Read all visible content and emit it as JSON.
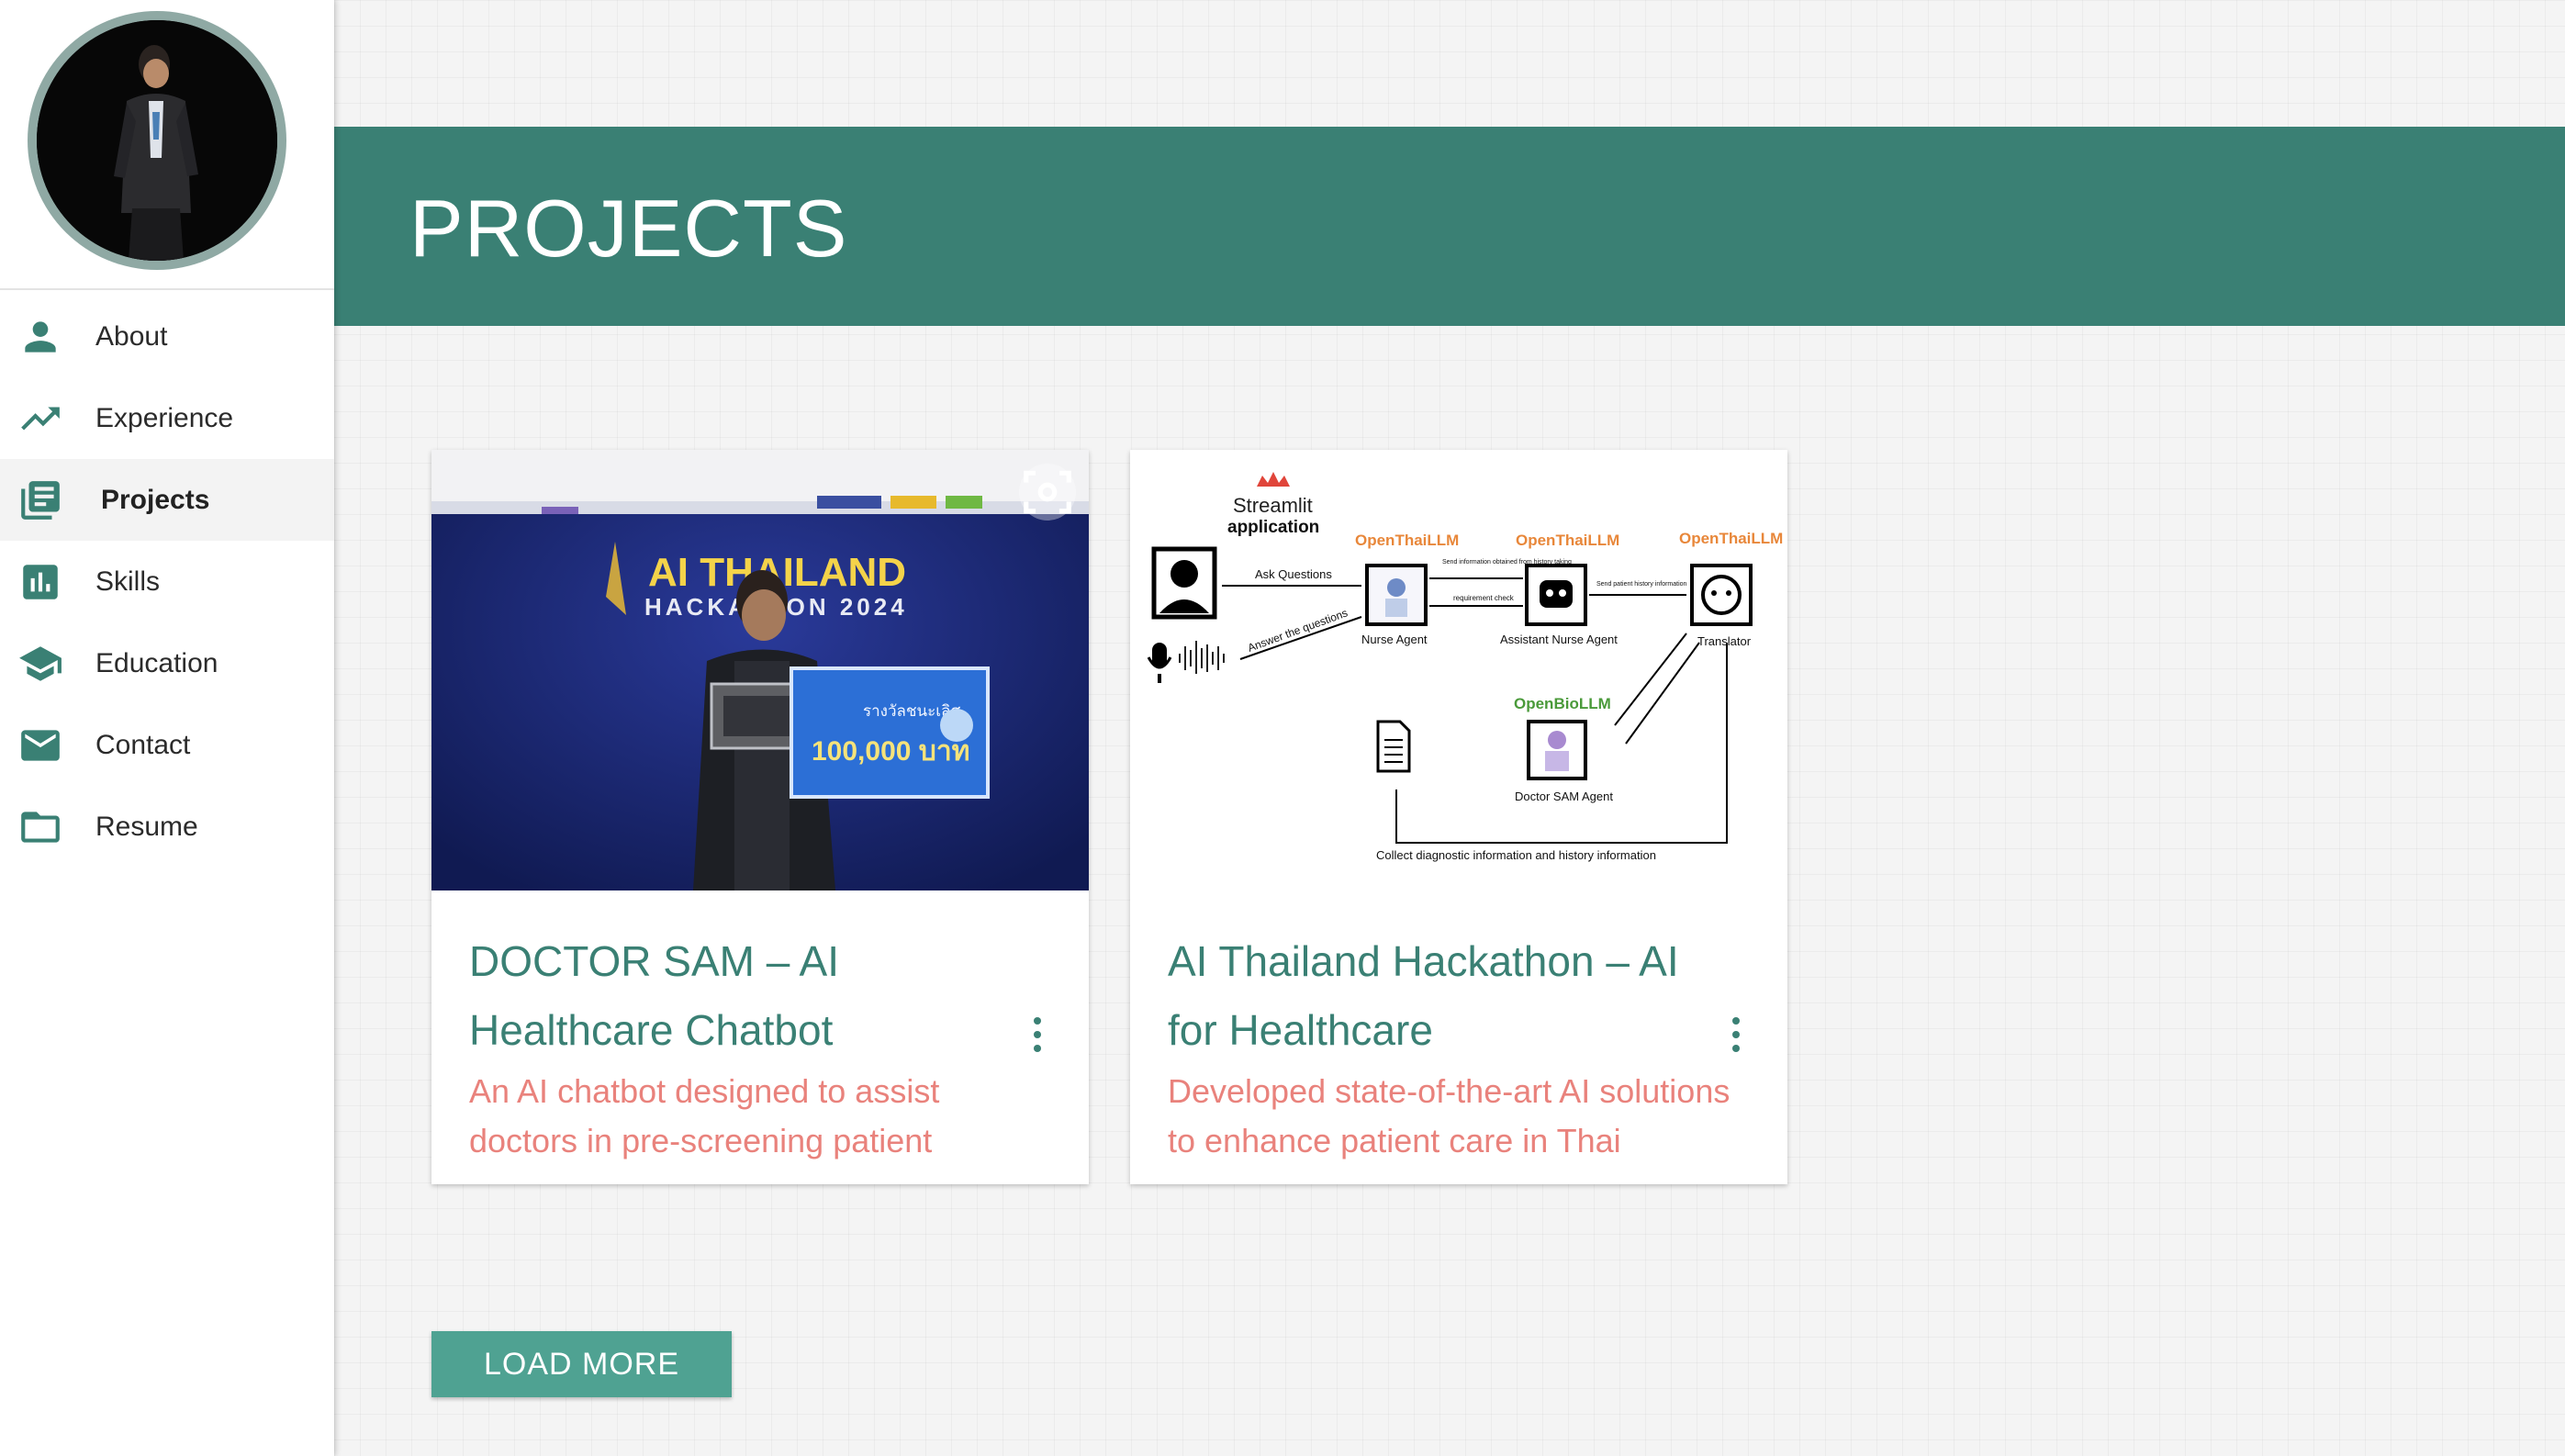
{
  "nav": {
    "items": [
      {
        "label": "About",
        "icon": "person-icon"
      },
      {
        "label": "Experience",
        "icon": "trending-up-icon"
      },
      {
        "label": "Projects",
        "icon": "article-icon",
        "active": true
      },
      {
        "label": "Skills",
        "icon": "bar-chart-icon"
      },
      {
        "label": "Education",
        "icon": "school-icon"
      },
      {
        "label": "Contact",
        "icon": "mail-icon"
      },
      {
        "label": "Resume",
        "icon": "folder-icon"
      }
    ]
  },
  "header": {
    "title": "PROJECTS"
  },
  "cards": [
    {
      "title": "DOCTOR SAM – AI Healthcare Chatbot",
      "description": "An AI chatbot designed to assist doctors in pre-screening patient",
      "image_text": {
        "headline": "AI THAILAND",
        "subline": "HACKATHON 2024",
        "prize": "100,000 บาท",
        "prize_caption": "รางวัลชนะเลิศ"
      }
    },
    {
      "title": "AI Thailand Hackathon – AI for Healthcare",
      "description": "Developed state-of-the-art AI solutions to enhance patient care in Thai",
      "diagram": {
        "app_title": "Streamlit",
        "app_subtitle": "application",
        "llm1": "OpenThaiLLM",
        "llm2": "OpenThaiLLM",
        "llm3": "OpenThaiLLM",
        "bio": "OpenBioLLM",
        "ask": "Ask Questions",
        "answer": "Answer the questions",
        "send_info": "Send information obtained from history taking",
        "req_check": "requirement check",
        "send_history": "Send patient history information",
        "nurse": "Nurse Agent",
        "assistant": "Assistant Nurse Agent",
        "translator": "Translator",
        "doctor": "Doctor SAM Agent",
        "collect": "Collect diagnostic information and history information"
      }
    }
  ],
  "load_more": "LOAD MORE",
  "colors": {
    "primary": "#3a8074",
    "button": "#4fa292",
    "accent_text": "#e9827c"
  }
}
